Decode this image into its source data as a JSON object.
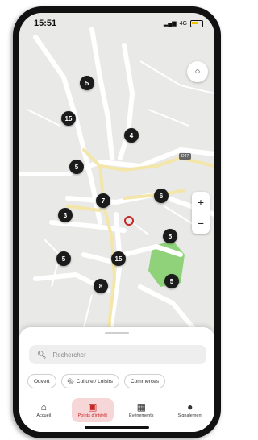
{
  "status": {
    "time": "15:51",
    "network": "4G"
  },
  "map": {
    "clusters": [
      "5",
      "15",
      "5",
      "4",
      "7",
      "3",
      "6",
      "5",
      "5",
      "15",
      "8",
      "5"
    ],
    "road_label": "D47"
  },
  "search": {
    "placeholder": "Rechercher"
  },
  "chips": [
    "Ouvert",
    "Culture / Loisirs",
    "Commerces"
  ],
  "tabs": [
    "Accueil",
    "Points d'intérêt",
    "Événements",
    "Signalement"
  ],
  "colors": {
    "accent": "#c62828",
    "active_tab_bg": "#f6d6d6",
    "park": "#8fd27a"
  }
}
